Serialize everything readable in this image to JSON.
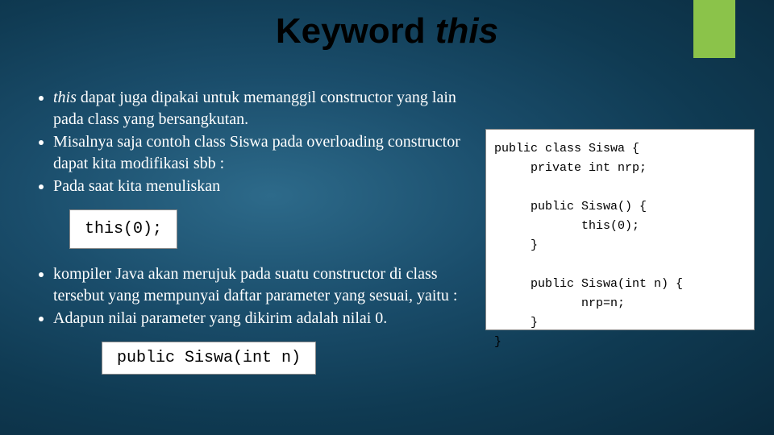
{
  "title": {
    "word": "Keyword",
    "kw": "this"
  },
  "bullets": {
    "b1_pre": "",
    "b1_kw": "this",
    "b1_post": " dapat juga dipakai untuk memanggil constructor yang lain pada class yang bersangkutan.",
    "b2": "Misalnya saja contoh class Siswa pada overloading constructor dapat kita modifikasi sbb :",
    "b3": "Pada saat kita menuliskan",
    "b4": "kompiler Java akan merujuk pada suatu constructor di class tersebut yang mempunyai daftar parameter yang sesuai, yaitu :",
    "b5": " Adapun nilai parameter yang dikirim adalah nilai 0."
  },
  "snippets": {
    "s1": "this(0);",
    "s2": "public Siswa(int n)"
  },
  "code": "public class Siswa {\n     private int nrp;\n\n     public Siswa() {\n            this(0);\n     }\n\n     public Siswa(int n) {\n            nrp=n;\n     }\n}"
}
